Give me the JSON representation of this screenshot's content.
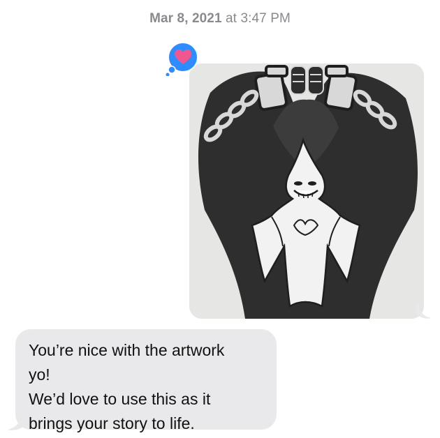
{
  "conversation": {
    "timestamp_date": "Mar 8, 2021",
    "timestamp_time": " at 3:47 PM",
    "image_message": {
      "tapback_icon": "heart-icon",
      "image_subject": "chained-figure-artwork"
    },
    "text_message": {
      "lines": [
        "You’re nice with the artwork",
        "yo!",
        "We’d love to use this as it",
        "brings your story to life."
      ]
    }
  },
  "colors": {
    "bubble_gray": "#e9e9eb",
    "tapback_blue": "#2d8cff",
    "heart_pink": "#f0578f",
    "timestamp_gray": "#8a8a8e"
  }
}
